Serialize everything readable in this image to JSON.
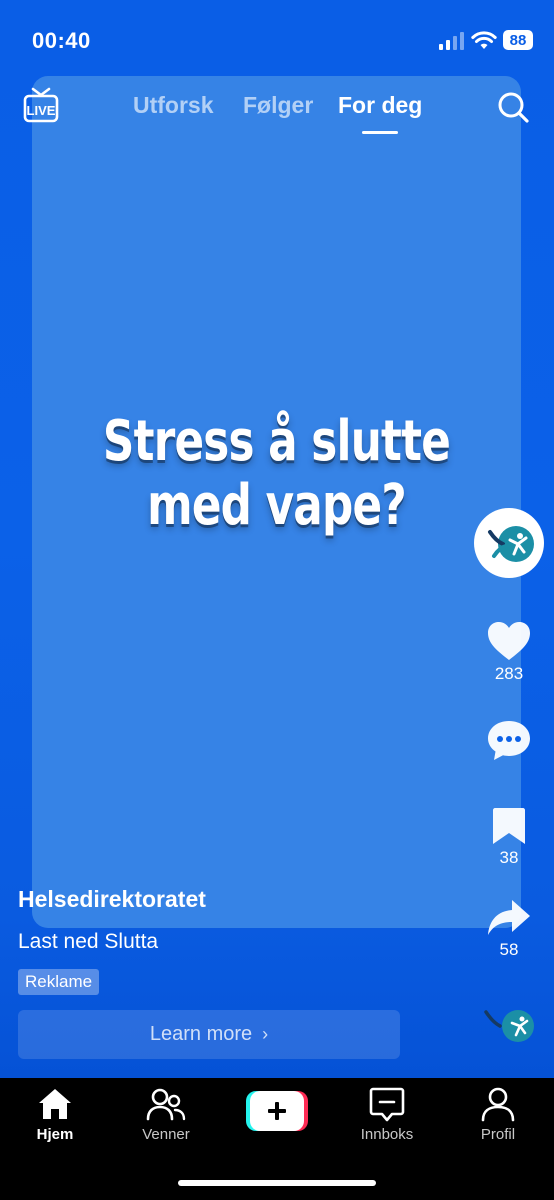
{
  "status_bar": {
    "time": "00:40",
    "battery": "88"
  },
  "top_nav": {
    "live_label": "LIVE",
    "tabs": [
      {
        "label": "Utforsk",
        "active": false
      },
      {
        "label": "Følger",
        "active": false
      },
      {
        "label": "For deg",
        "active": true
      }
    ]
  },
  "video": {
    "headline_line1": "Stress å slutte",
    "headline_line2": "med vape?"
  },
  "actions": {
    "likes": "283",
    "comments": "",
    "saves": "38",
    "shares": "58"
  },
  "post": {
    "author": "Helsedirektoratet",
    "caption": "Last ned Slutta",
    "ad_badge": "Reklame",
    "cta_label": "Learn more",
    "cta_chevron": "›"
  },
  "bottom_nav": {
    "items": [
      {
        "label": "Hjem",
        "icon": "home-icon",
        "active": true
      },
      {
        "label": "Venner",
        "icon": "friends-icon",
        "active": false
      },
      {
        "label": "Innboks",
        "icon": "inbox-icon",
        "active": false
      },
      {
        "label": "Profil",
        "icon": "profile-icon",
        "active": false
      }
    ],
    "create_icon": "plus-icon"
  },
  "colors": {
    "background": "#0a5ee6",
    "card": "#3683e6",
    "logo_teal": "#1b8fa6",
    "logo_navy": "#153a63",
    "plus_cyan": "#25f4ee",
    "plus_pink": "#fe2c55"
  }
}
